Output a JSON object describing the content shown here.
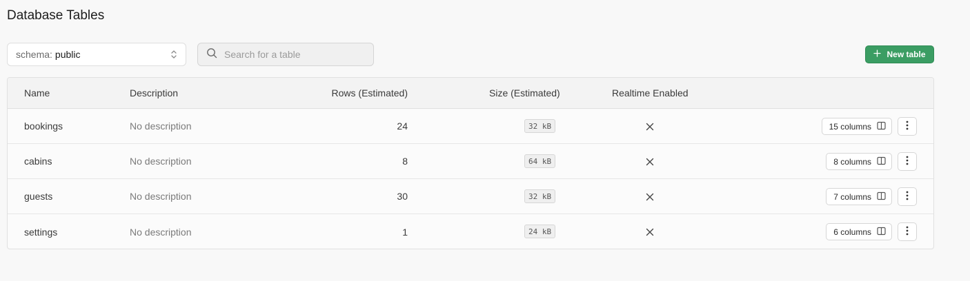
{
  "page": {
    "title": "Database Tables"
  },
  "schema_select": {
    "prefix": "schema:",
    "value": "public",
    "icon": "chevron-up-down-icon"
  },
  "search": {
    "placeholder": "Search for a table",
    "value": "",
    "icon": "search-icon"
  },
  "new_table_button": {
    "label": "New table",
    "icon": "plus-icon"
  },
  "table": {
    "headers": {
      "name": "Name",
      "description": "Description",
      "rows": "Rows (Estimated)",
      "size": "Size (Estimated)",
      "realtime": "Realtime Enabled"
    },
    "rows": [
      {
        "name": "bookings",
        "description": "No description",
        "rows": "24",
        "size": "32 kB",
        "realtime": "x-icon",
        "columns": "15 columns"
      },
      {
        "name": "cabins",
        "description": "No description",
        "rows": "8",
        "size": "64 kB",
        "realtime": "x-icon",
        "columns": "8 columns"
      },
      {
        "name": "guests",
        "description": "No description",
        "rows": "30",
        "size": "32 kB",
        "realtime": "x-icon",
        "columns": "7 columns"
      },
      {
        "name": "settings",
        "description": "No description",
        "rows": "1",
        "size": "24 kB",
        "realtime": "x-icon",
        "columns": "6 columns"
      }
    ]
  },
  "colors": {
    "accent": "#3b9d63",
    "background": "#f8f8f8"
  }
}
